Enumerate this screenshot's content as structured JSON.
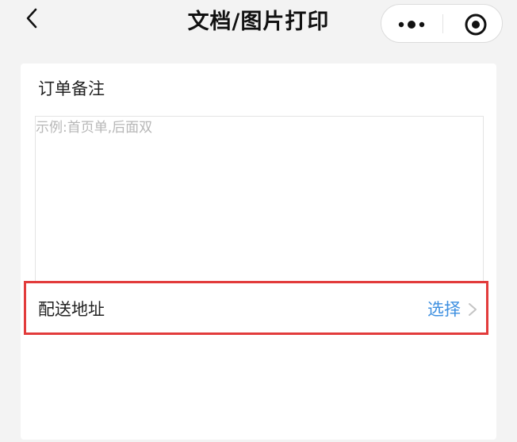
{
  "navbar": {
    "title": "文档/图片打印",
    "back_icon": "chevron-left-icon",
    "more_icon": "more-dots-icon",
    "close_icon": "target-circle-icon"
  },
  "remark": {
    "label": "订单备注",
    "placeholder": "示例:首页单,后面双"
  },
  "address": {
    "label": "配送地址",
    "action": "选择",
    "chevron_icon": "chevron-right-icon",
    "action_color": "#3d8fe0",
    "highlight_color": "#e23b3b"
  }
}
